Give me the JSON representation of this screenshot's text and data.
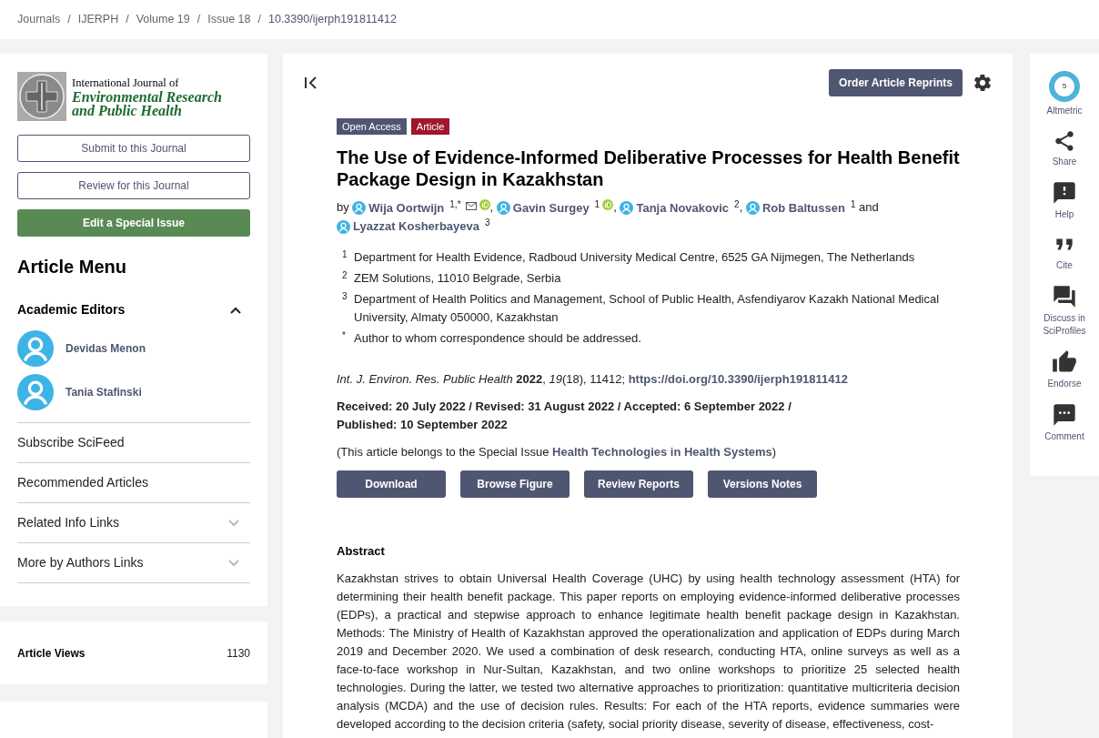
{
  "breadcrumb": [
    {
      "label": "Journals",
      "current": false
    },
    {
      "label": "IJERPH",
      "current": false
    },
    {
      "label": "Volume 19",
      "current": false
    },
    {
      "label": "Issue 18",
      "current": false
    },
    {
      "label": "10.3390/ijerph191811412",
      "current": true
    }
  ],
  "breadcrumb_separator": "/",
  "journal": {
    "line1": "International Journal of",
    "line2": "Environmental Research",
    "line3": "and Public Health"
  },
  "journal_buttons": [
    {
      "label": "Submit to this Journal",
      "kind": "outline"
    },
    {
      "label": "Review for this Journal",
      "kind": "outline"
    },
    {
      "label": "Edit a Special Issue",
      "kind": "filled"
    }
  ],
  "article_menu": {
    "title": "Article Menu",
    "section": {
      "title": "Academic Editors",
      "expanded": true,
      "editors": [
        "Devidas Menon",
        "Tania Stafinski"
      ]
    },
    "items": [
      {
        "label": "Subscribe SciFeed",
        "kind": "link"
      },
      {
        "label": "Recommended Articles",
        "kind": "link"
      },
      {
        "label": "Related Info Links",
        "kind": "dropdown",
        "expanded": false
      },
      {
        "label": "More by Authors Links",
        "kind": "dropdown",
        "expanded": false
      }
    ]
  },
  "stats": {
    "label": "Article Views",
    "value": "1130"
  },
  "toolbar": {
    "order_button": "Order Article Reprints"
  },
  "badges": [
    {
      "label": "Open Access",
      "color": "#4f5671"
    },
    {
      "label": "Article",
      "color": "#a0162a"
    }
  ],
  "title": "The Use of Evidence-Informed Deliberative Processes for Health Benefit Package Design in Kazakhstan",
  "by": "by",
  "authors": [
    {
      "name": "Wija Oortwijn",
      "marks": "1,*",
      "email": true,
      "orcid": true,
      "separator": ","
    },
    {
      "name": "Gavin Surgey",
      "marks": "1",
      "email": false,
      "orcid": true,
      "separator": ","
    },
    {
      "name": "Tanja Novakovic",
      "marks": "2",
      "email": false,
      "orcid": false,
      "separator": ","
    },
    {
      "name": "Rob Baltussen",
      "marks": "1",
      "email": false,
      "orcid": false,
      "separator": "and"
    },
    {
      "name": "Lyazzat Kosherbayeva",
      "marks": "3",
      "email": false,
      "orcid": false
    }
  ],
  "affiliations": [
    {
      "mark": "1",
      "text": "Department for Health Evidence, Radboud University Medical Centre, 6525 GA Nijmegen, The Netherlands"
    },
    {
      "mark": "2",
      "text": "ZEM Solutions, 11010 Belgrade, Serbia"
    },
    {
      "mark": "3",
      "text": "Department of Health Politics and Management, School of Public Health, Asfendiyarov Kazakh National Medical University, Almaty 050000, Kazakhstan"
    },
    {
      "mark": "*",
      "text": "Author to whom correspondence should be addressed."
    }
  ],
  "citation": {
    "text": "*Int. J. Environ. Res. Public Health* **2022**, *19*(18), 11412;",
    "doi": "https://doi.org/10.3390/ijerph191811412"
  },
  "dates": "Received: 20 July 2022 / Revised: 31 August 2022 / Accepted: 6 September 2022 / Published: 10 September 2022",
  "special_issue": {
    "prefix": "(This article belongs to the Special Issue",
    "link": "Health Technologies in Health Systems",
    "suffix": ")"
  },
  "actions": [
    "Download",
    "Browse Figure",
    "Review Reports",
    "Versions Notes"
  ],
  "abstract": {
    "heading": "Abstract",
    "text": "Kazakhstan strives to obtain Universal Health Coverage (UHC) by using health technology assessment (HTA) for determining their health benefit package. This paper reports on employing evidence-informed deliberative processes (EDPs), a practical and stepwise approach to enhance legitimate health benefit package design in Kazakhstan. Methods: The Ministry of Health of Kazakhstan approved the operationalization and application of EDPs during March 2019 and December 2020. We used a combination of desk research, conducting HTA, online surveys as well as a face-to-face workshop in Nur-Sultan, Kazakhstan, and two online workshops to prioritize 25 selected health technologies. During the latter, we tested two alternative approaches to prioritization: quantitative multicriteria decision analysis (MCDA) and the use of decision rules. Results: For each of the HTA reports, evidence summaries were developed according to the decision criteria (safety, social priority disease, severity of disease, effectiveness, cost-"
  },
  "side_tools": [
    {
      "kind": "altmetric",
      "label": "Altmetric",
      "score": "5"
    },
    {
      "kind": "share",
      "label": "Share"
    },
    {
      "kind": "help",
      "label": "Help"
    },
    {
      "kind": "cite",
      "label": "Cite"
    },
    {
      "kind": "discuss",
      "label": "Discuss in SciProfiles"
    },
    {
      "kind": "endorse",
      "label": "Endorse"
    },
    {
      "kind": "comment",
      "label": "Comment"
    }
  ]
}
